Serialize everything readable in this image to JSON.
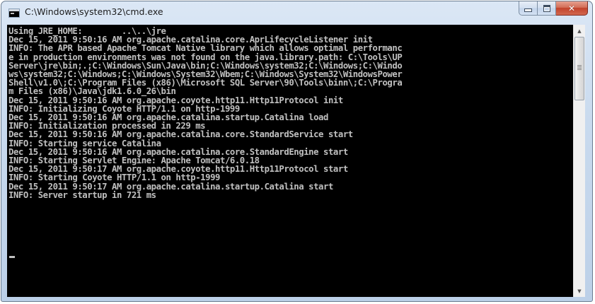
{
  "window": {
    "title": "C:\\Windows\\system32\\cmd.exe",
    "icon": "console-icon",
    "buttons": {
      "minimize": "minimize-icon",
      "maximize": "maximize-icon",
      "close": "close-icon"
    }
  },
  "console": {
    "lines": [
      "Using JRE_HOME:        ..\\..\\jre",
      "Dec 15, 2011 9:50:16 AM org.apache.catalina.core.AprLifecycleListener init",
      "INFO: The APR based Apache Tomcat Native library which allows optimal performanc",
      "e in production environments was not found on the java.library.path: C:\\Tools\\UP",
      "Server\\jre\\bin;.;C:\\Windows\\Sun\\Java\\bin;C:\\Windows\\system32;C:\\Windows;C:\\Windo",
      "ws\\system32;C:\\Windows;C:\\Windows\\System32\\Wbem;C:\\Windows\\System32\\WindowsPower",
      "Shell\\v1.0\\;C:\\Program Files (x86)\\Microsoft SQL Server\\90\\Tools\\binn\\;C:\\Progra",
      "m Files (x86)\\Java\\jdk1.6.0_26\\bin",
      "Dec 15, 2011 9:50:16 AM org.apache.coyote.http11.Http11Protocol init",
      "INFO: Initializing Coyote HTTP/1.1 on http-1999",
      "Dec 15, 2011 9:50:16 AM org.apache.catalina.startup.Catalina load",
      "INFO: Initialization processed in 229 ms",
      "Dec 15, 2011 9:50:16 AM org.apache.catalina.core.StandardService start",
      "INFO: Starting service Catalina",
      "Dec 15, 2011 9:50:16 AM org.apache.catalina.core.StandardEngine start",
      "INFO: Starting Servlet Engine: Apache Tomcat/6.0.18",
      "Dec 15, 2011 9:50:17 AM org.apache.coyote.http11.Http11Protocol start",
      "INFO: Starting Coyote HTTP/1.1 on http-1999",
      "Dec 15, 2011 9:50:17 AM org.apache.catalina.startup.Catalina start",
      "INFO: Server startup in 721 ms"
    ],
    "cursor": "_"
  },
  "scrollbar": {
    "up_arrow": "▲",
    "down_arrow": "▼"
  },
  "colors": {
    "console_background": "#000000",
    "console_text": "#c0c0c0",
    "close_button": "#c74a33"
  }
}
